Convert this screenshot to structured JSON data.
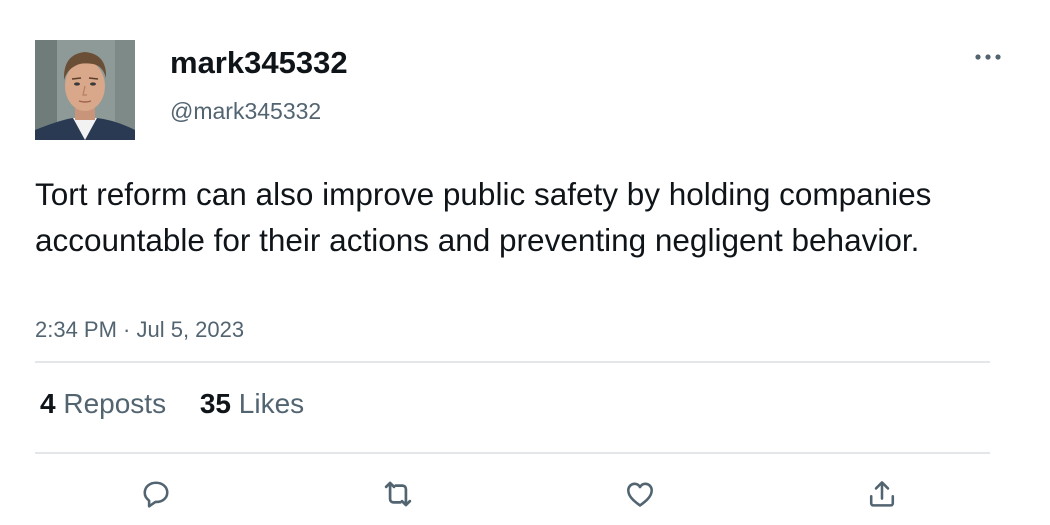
{
  "author": {
    "display_name": "mark345332",
    "handle": "@mark345332",
    "avatar_icon": "user-avatar-photo"
  },
  "tweet": {
    "text": "Tort reform can also improve public safety by holding companies accountable for their actions and preventing negligent behavior.",
    "timestamp": "2:34 PM · Jul 5, 2023"
  },
  "stats": {
    "reposts_count": "4",
    "reposts_label": "Reposts",
    "likes_count": "35",
    "likes_label": "Likes"
  },
  "actions": [
    {
      "icon": "reply-icon"
    },
    {
      "icon": "repost-icon"
    },
    {
      "icon": "like-icon"
    },
    {
      "icon": "share-icon"
    }
  ],
  "colors": {
    "primary_text": "#0f1419",
    "secondary_text": "#536471",
    "divider": "#e4e7ea",
    "icon": "#536471"
  }
}
